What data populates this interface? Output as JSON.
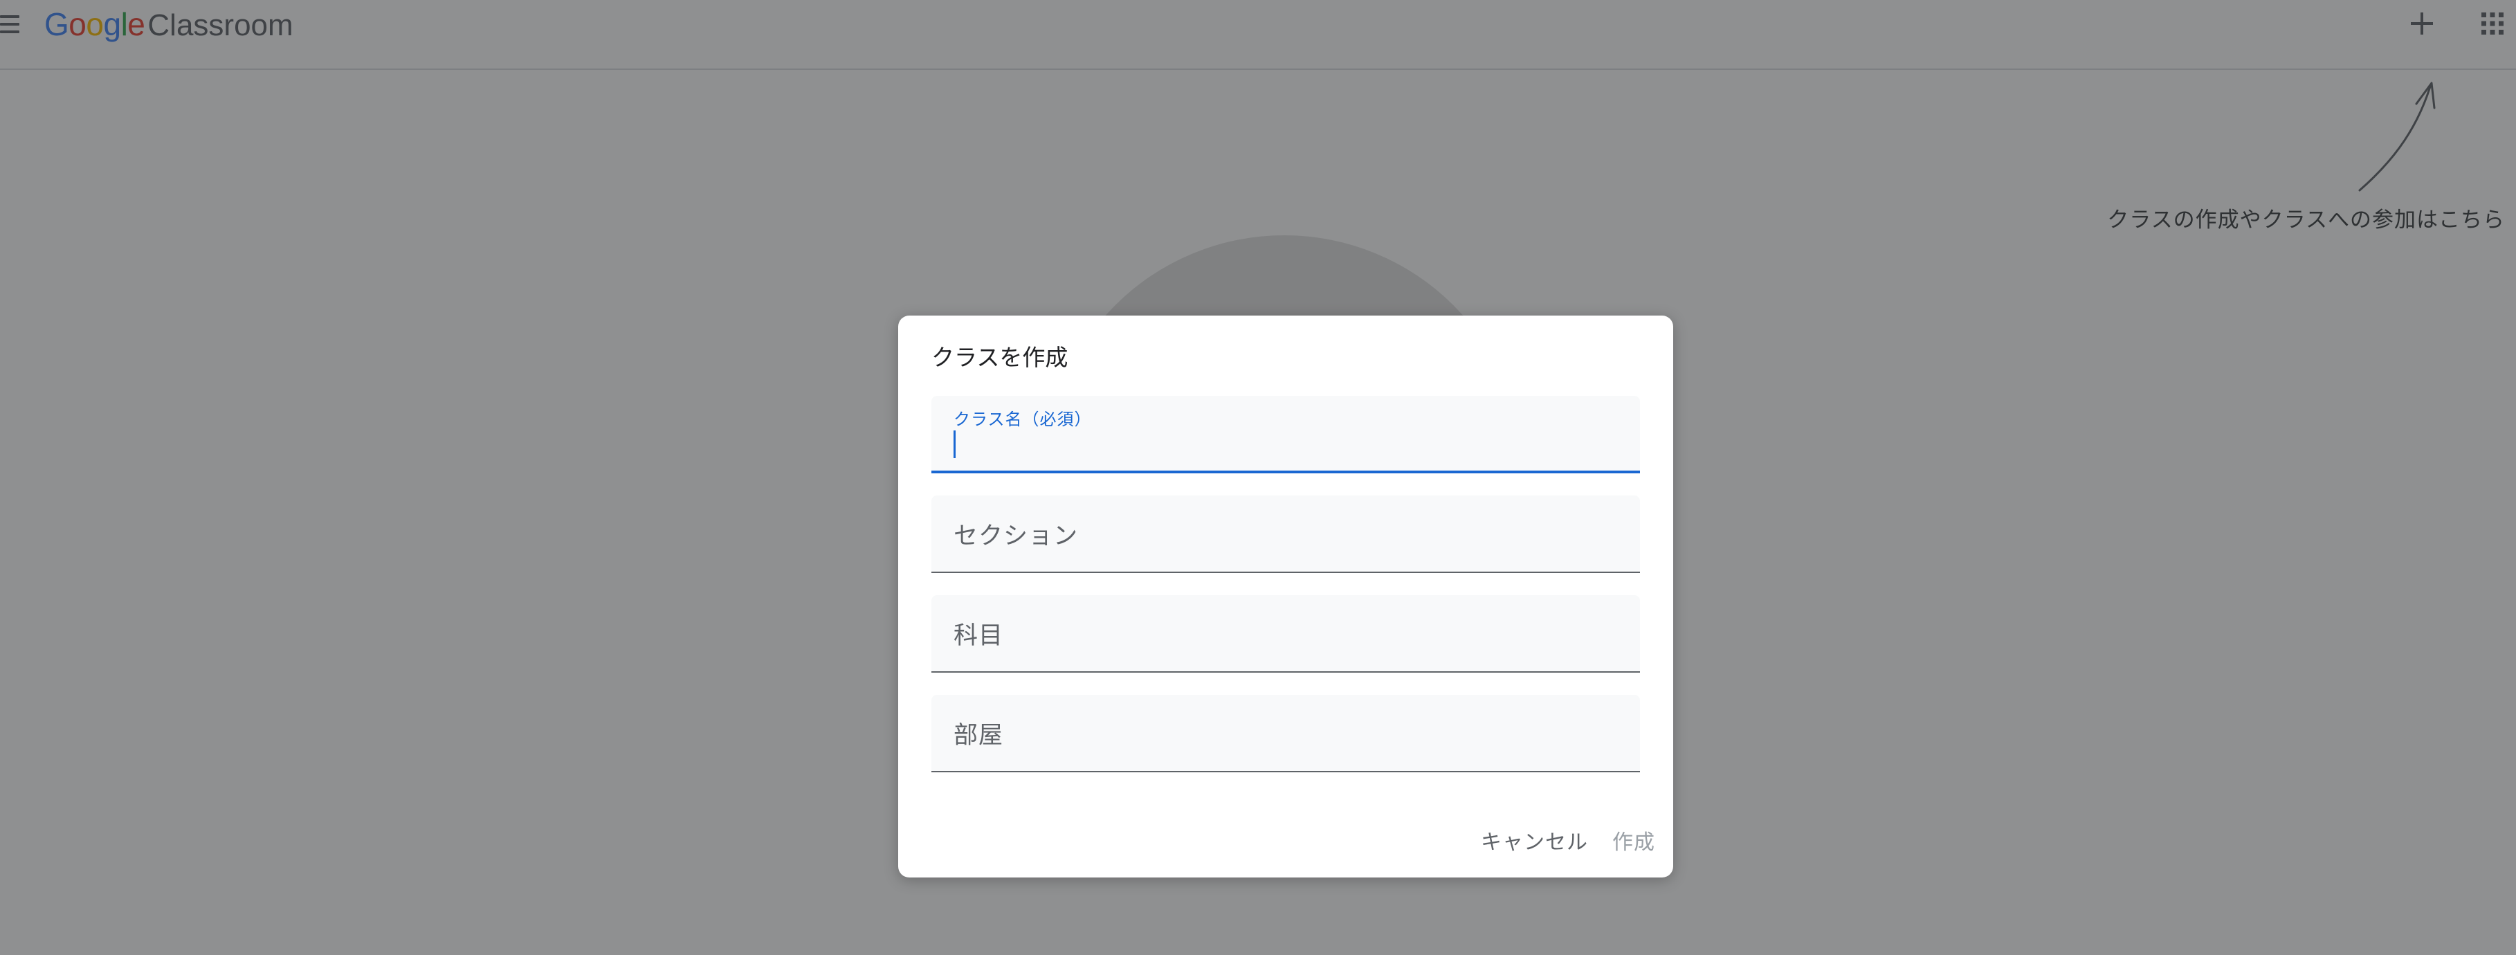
{
  "app": {
    "logo_google_letters": [
      "G",
      "o",
      "o",
      "g",
      "l",
      "e"
    ],
    "logo_product": "Classroom"
  },
  "header": {
    "menu_icon": "hamburger-menu-icon",
    "add_icon": "plus-icon",
    "apps_icon": "apps-grid-icon"
  },
  "background": {
    "hint_text": "クラスの作成やクラスへの参加はこちら"
  },
  "dialog": {
    "title": "クラスを作成",
    "fields": {
      "class_name": {
        "label": "クラス名（必須）",
        "value": ""
      },
      "section": {
        "label": "セクション",
        "value": ""
      },
      "subject": {
        "label": "科目",
        "value": ""
      },
      "room": {
        "label": "部屋",
        "value": ""
      }
    },
    "buttons": {
      "cancel": "キャンセル",
      "create": "作成"
    }
  },
  "colors": {
    "accent": "#1967d2",
    "scrim": "#202124",
    "google_blue": "#4285f4",
    "google_red": "#ea4335",
    "google_yellow": "#fbbc05",
    "google_green": "#34a853"
  }
}
